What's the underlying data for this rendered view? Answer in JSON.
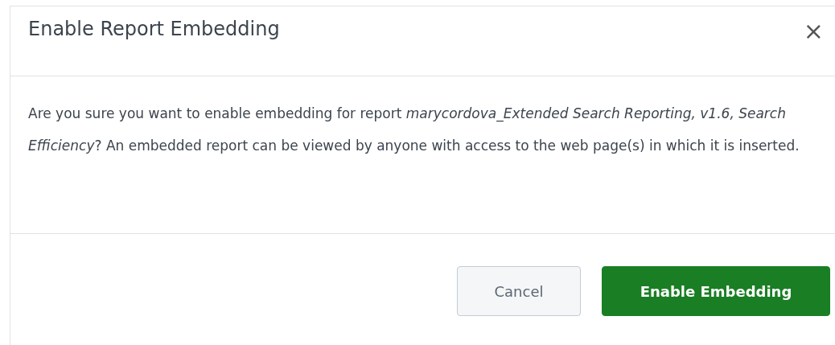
{
  "dialog": {
    "title": "Enable Report Embedding",
    "close": "×",
    "message": "Are you sure you want to enable embedding for report *marycordova_Extended Search Reporting, v1.6, Search Efficiency*? An embedded report can be viewed by anyone with access to the web page(s) in which it is inserted.",
    "buttons": [
      {
        "label": "Cancel",
        "kind": "secondary"
      },
      {
        "label": "Enable Embedding",
        "kind": "primary"
      }
    ]
  }
}
